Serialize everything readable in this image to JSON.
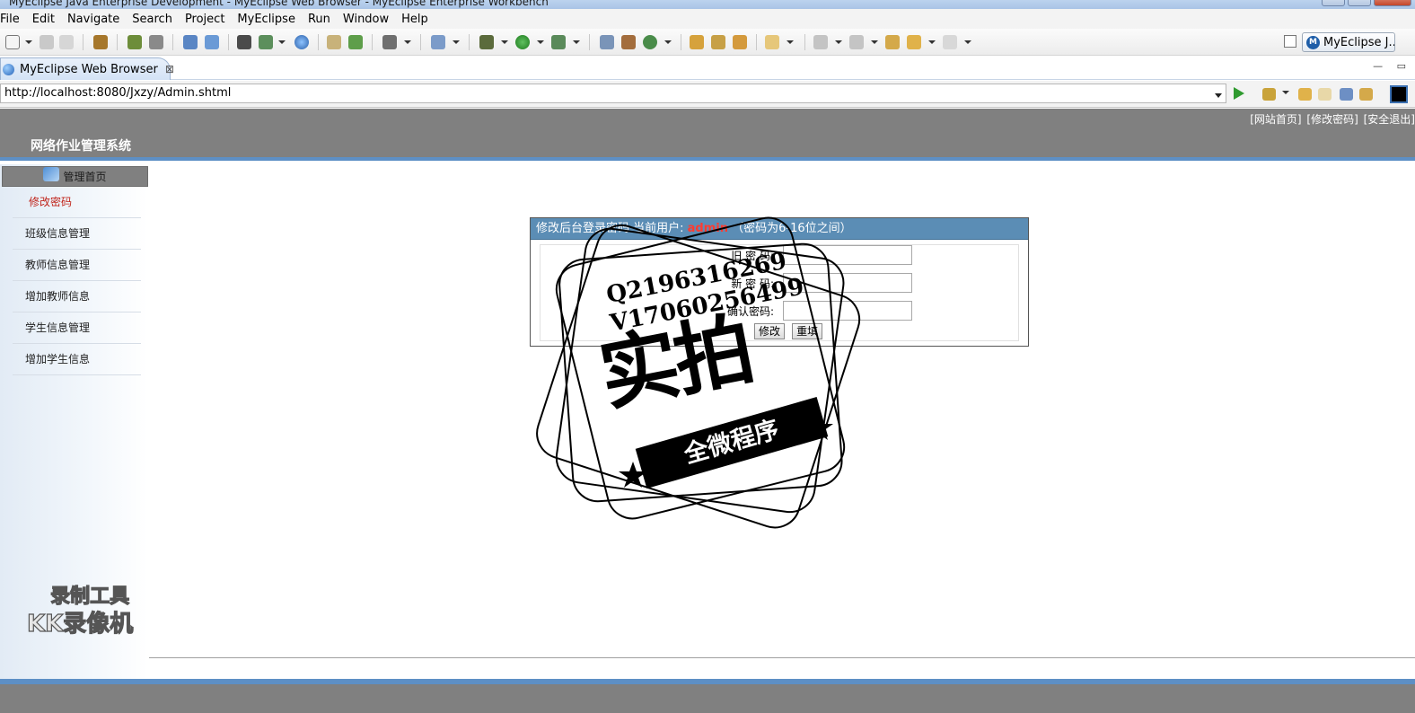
{
  "window": {
    "title": "MyEclipse Java Enterprise Development - MyEclipse Web Browser - MyEclipse Enterprise Workbench"
  },
  "menu": [
    "File",
    "Edit",
    "Navigate",
    "Search",
    "Project",
    "MyEclipse",
    "Run",
    "Window",
    "Help"
  ],
  "toolbar": {
    "perspective_label": "MyEclipse J..."
  },
  "editor": {
    "tab_label": "MyEclipse Web Browser",
    "close_glyph": "⊠"
  },
  "browser": {
    "url": "http://localhost:8080/Jxzy/Admin.shtml"
  },
  "site": {
    "title": "网络作业管理系统",
    "top_links": [
      "[网站首页]",
      "[修改密码]",
      "[安全退出]"
    ],
    "sidebar": {
      "home_label": "管理首页",
      "items": [
        {
          "label": "修改密码",
          "active": true
        },
        {
          "label": "班级信息管理",
          "active": false
        },
        {
          "label": "教师信息管理",
          "active": false
        },
        {
          "label": "增加教师信息",
          "active": false
        },
        {
          "label": "学生信息管理",
          "active": false
        },
        {
          "label": "增加学生信息",
          "active": false
        }
      ]
    }
  },
  "password_form": {
    "header_prefix": "修改后台登录密码 当前用户:",
    "current_user": "admin",
    "header_hint": "（密码为6-16位之间）",
    "fields": [
      {
        "label": "旧 密 码:",
        "value": ""
      },
      {
        "label": "新 密 码:",
        "value": ""
      },
      {
        "label": "确认密码:",
        "value": ""
      }
    ],
    "submit_label": "修改",
    "reset_label": "重填"
  },
  "watermarks": {
    "recorder_line1": "录制工具",
    "recorder_line2": "KK录像机",
    "stamp_phone_q": "Q2196316269",
    "stamp_phone_v": "V17060256499",
    "stamp_big": "实拍",
    "stamp_banner": "全微程序"
  },
  "colors": {
    "header_gray": "#808080",
    "accent_blue": "#5d8fc5",
    "panel_head": "#5b8db5",
    "active_red": "#c0241b",
    "user_red": "#ff3b30"
  }
}
